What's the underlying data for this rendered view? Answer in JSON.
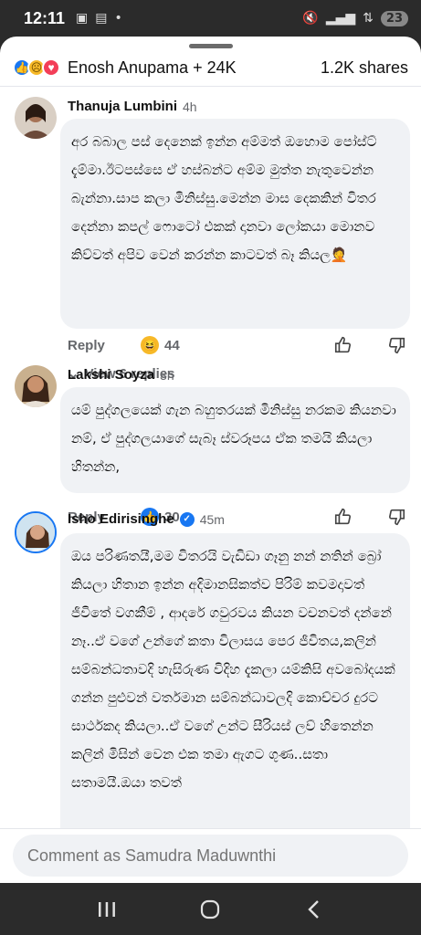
{
  "status_bar": {
    "time": "12:11",
    "battery": "23"
  },
  "header": {
    "reactors": "Enosh Anupama + 24K",
    "shares": "1.2K shares",
    "reaction_icons": [
      "like-icon",
      "sad-icon",
      "love-icon"
    ]
  },
  "comments": [
    {
      "author": "Thanuja Lumbini",
      "time": "4h",
      "text": "අර බබාල පස් දෙනෙක් ඉන්න අම්මත් ඔහොම පෝස්ට් දැම්මා.ඊටපස්සෙ ඒ හස්බන්ට අම්ම මුත්ත නැතුවෙන්න බැන්නා.සාප කලා මිනිස්සු.මෙන්න මාස දෙකකින් විතර දෙන්නා කපල් ෆොටෝ එකක් දානවා ලෝකයා මොනව කිව්වත් අපිව වෙන් කරන්න කාටවත් බෑ කියල🤦",
      "reply_label": "Reply",
      "reaction_icon": "laugh-icon",
      "reaction_count": "44",
      "view_replies": "View 6 replies"
    },
    {
      "author": "Lakshi Soyza",
      "time": "3h",
      "text": "යම් පුද්ගලයෙක් ගැන බහුතරයක් මිනිස්සු නරකම කියනවා නම්, ඒ පුද්ගලයාගේ සැබෑ ස්වරූපය ඒක තමයි කියලා හිතන්න,",
      "reply_label": "Reply",
      "reaction_icon": "like-icon",
      "reaction_count": "30"
    },
    {
      "author": "Isho Edirisinghe",
      "time": "45m",
      "verified": true,
      "text": "ඔය පරිණතයී,මම විතරයි වැඩිඩා ගෑනු නන් නතින් බ්‍රෝ කියලා හිතාන ඉන්න අදිමානසිකත්ව පිරිම් කවමදාවත් ජීවිතේ වගකීම් , ආදරේ ගවුරවය කියන වචනවත් දන්නේ නෑ..ඒ වගේ උන්ගේ කතා විලාසය පෙර ජීවිතය,කලින් සම්බන්ධතාවදි හැසිරුණ විදිහ දැකලා යම්කිසි අවබෝදයක් ගන්න පුළුවන් වර්තමාන සම්බන්ධාවලදි කොච්චර දුරට සාර්ථකද කියලා..ඒ වගේ උන්ට සීරියස් ලව් හිතෙන්න කලින් මිසින් වෙන එක තමා ඇගට ගුණ..සතා සතාමයී.ඔයා තවත්"
    }
  ],
  "composer": {
    "placeholder": "Comment as Samudra Maduwnthi"
  },
  "colors": {
    "accent": "#1877f2",
    "bubble": "#f0f2f5",
    "muted": "#65676b"
  }
}
